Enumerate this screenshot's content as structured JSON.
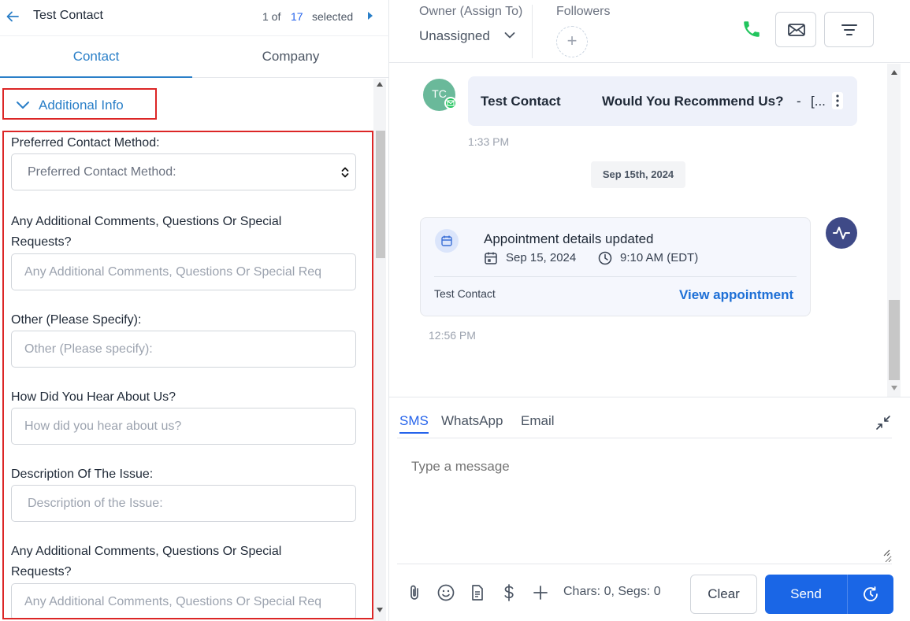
{
  "left_panel": {
    "contact_name": "Test Contact",
    "selection": {
      "prefix": "1 of",
      "count": "17",
      "suffix": "selected"
    },
    "tabs": [
      {
        "label": "Contact"
      },
      {
        "label": "Company"
      }
    ],
    "section_title": "Additional Info",
    "fields": [
      {
        "label": "Preferred Contact Method:",
        "placeholder": "Preferred Contact Method:",
        "type": "select"
      },
      {
        "label_line1": "Any Additional Comments, Questions Or Special",
        "label_line2": "Requests?",
        "placeholder": "Any Additional Comments, Questions Or Special Req"
      },
      {
        "label": "Other (Please Specify):",
        "placeholder": "Other (Please specify):"
      },
      {
        "label": "How Did You Hear About Us?",
        "placeholder": "How did you hear about us?"
      },
      {
        "label": "Description Of The Issue:",
        "placeholder": "Description of the Issue:"
      },
      {
        "label_line1": "Any Additional Comments, Questions Or Special",
        "label_line2": "Requests?",
        "placeholder": "Any Additional Comments, Questions Or Special Req"
      }
    ]
  },
  "header": {
    "owner_label": "Owner (Assign To)",
    "owner_value": "Unassigned",
    "followers_label": "Followers",
    "add_follower": "+"
  },
  "conversation": {
    "message": {
      "avatar_initials": "TC",
      "sender": "Test Contact",
      "subject": "Would You Recommend Us?",
      "separator": "-",
      "ellipsis": "[...",
      "time": "1:33 PM"
    },
    "date_divider": "Sep 15th, 2024",
    "appointment": {
      "title": "Appointment details updated",
      "date": "Sep 15, 2024",
      "time": "9:10 AM (EDT)",
      "contact": "Test Contact",
      "link": "View appointment",
      "time_sent": "12:56 PM"
    }
  },
  "composer": {
    "tabs": [
      {
        "label": "SMS"
      },
      {
        "label": "WhatsApp"
      },
      {
        "label": "Email"
      }
    ],
    "placeholder": "Type a message",
    "counter": "Chars: 0, Segs: 0",
    "clear_label": "Clear",
    "send_label": "Send"
  },
  "colors": {
    "accent": "#2a7fc8",
    "send": "#1a66e6",
    "highlight_border": "#dc2626",
    "phone": "#22c55e",
    "activity": "#3f4a87"
  }
}
